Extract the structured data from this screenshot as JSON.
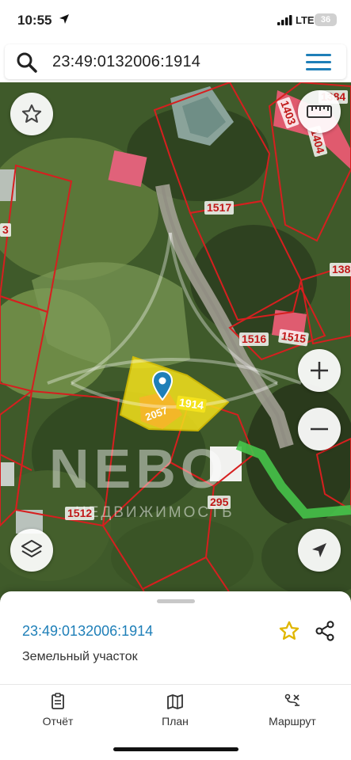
{
  "status_bar": {
    "time": "10:55",
    "network": "LTE",
    "battery": "36"
  },
  "search": {
    "query": "23:49:0132006:1914"
  },
  "map": {
    "parcel_labels": [
      {
        "text": "1384"
      },
      {
        "text": "1403"
      },
      {
        "text": "1404"
      },
      {
        "text": "1517"
      },
      {
        "text": "138"
      },
      {
        "text": "1516"
      },
      {
        "text": "1515"
      },
      {
        "text": "1914"
      },
      {
        "text": "2057"
      },
      {
        "text": "1512"
      },
      {
        "text": "295"
      },
      {
        "text": "3"
      }
    ],
    "watermark": {
      "brand": "NEBO",
      "subtitle": "НЕДВИЖИМОСТЬ"
    },
    "colors": {
      "selected_parcel": "#f4e21c",
      "boundary": "#d61f1f",
      "route": "#46c34a"
    }
  },
  "sheet": {
    "cadastral_number": "23:49:0132006:1914",
    "property_type": "Земельный участок"
  },
  "tabs": [
    {
      "label": "Отчёт",
      "icon": "report-icon"
    },
    {
      "label": "План",
      "icon": "map-plan-icon"
    },
    {
      "label": "Маршрут",
      "icon": "route-icon"
    }
  ]
}
